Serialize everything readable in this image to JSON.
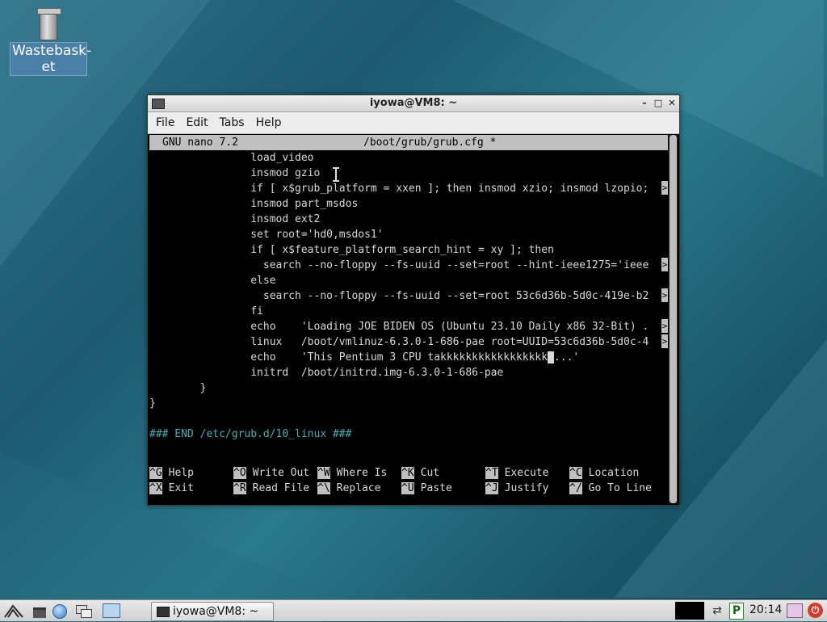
{
  "desktop": {
    "icons": [
      {
        "label": "Wastebask-\net",
        "icon": "trash-icon"
      }
    ]
  },
  "window": {
    "title": "iyowa@VM8: ~",
    "controls": {
      "minimize": "–",
      "maximize": "□",
      "close": "✕"
    },
    "menu": [
      "File",
      "Edit",
      "Tabs",
      "Help"
    ]
  },
  "nano": {
    "version": "GNU nano 7.2",
    "filename": "/boot/grub/grub.cfg *",
    "lines": [
      "                load_video",
      "                insmod gzio",
      "                if [ x$grub_platform = xxen ]; then insmod xzio; insmod lzopio;",
      "                insmod part_msdos",
      "                insmod ext2",
      "                set root='hd0,msdos1'",
      "                if [ x$feature_platform_search_hint = xy ]; then",
      "                  search --no-floppy --fs-uuid --set=root --hint-ieee1275='ieee",
      "                else",
      "                  search --no-floppy --fs-uuid --set=root 53c6d36b-5d0c-419e-b2",
      "                fi",
      "                echo    'Loading JOE BIDEN OS (Ubuntu 23.10 Daily x86 32-Bit) .",
      "                linux   /boot/vmlinuz-6.3.0-1-686-pae root=UUID=53c6d36b-5d0c-4",
      "                echo    'This Pentium 3 CPU takkkkkkkkkkkkkkkkk",
      "                initrd  /boot/initrd.img-6.3.0-1-686-pae",
      "        }",
      "}",
      "",
      "### END /etc/grub.d/10_linux ###"
    ],
    "cursor_line_rest": "...'",
    "overflow_marker": ">",
    "shortcuts_row1": [
      {
        "key": "^G",
        "label": "Help"
      },
      {
        "key": "^O",
        "label": "Write Out"
      },
      {
        "key": "^W",
        "label": "Where Is"
      },
      {
        "key": "^K",
        "label": "Cut"
      },
      {
        "key": "^T",
        "label": "Execute"
      },
      {
        "key": "^C",
        "label": "Location"
      }
    ],
    "shortcuts_row2": [
      {
        "key": "^X",
        "label": "Exit"
      },
      {
        "key": "^R",
        "label": "Read File"
      },
      {
        "key": "^\\",
        "label": "Replace"
      },
      {
        "key": "^U",
        "label": "Paste"
      },
      {
        "key": "^J",
        "label": "Justify"
      },
      {
        "key": "^/",
        "label": "Go To Line"
      }
    ]
  },
  "taskbar": {
    "task_label": "iyowa@VM8: ~",
    "clock": "20:14",
    "tray_p": "P",
    "power_symbol": "⏻"
  }
}
